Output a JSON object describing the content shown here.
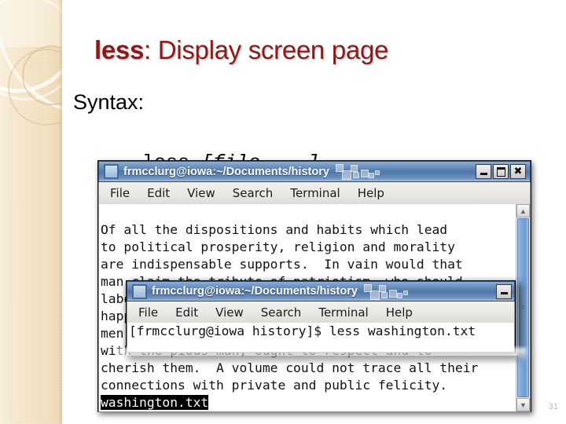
{
  "slide": {
    "title_command": "less",
    "title_rest": ": Display screen page",
    "title_color": "#8B1A1A",
    "syntax_label": "Syntax:",
    "syntax_command": "less ",
    "syntax_argument": "[file ...]",
    "page_number": "31"
  },
  "terminal_back": {
    "window_title": "frmcclurg@iowa:~/Documents/history",
    "window_icon": "terminal-window-icon",
    "buttons": {
      "minimize": "minimize-icon",
      "maximize": "maximize-icon",
      "close": "close-icon"
    },
    "menu": [
      "File",
      "Edit",
      "View",
      "Search",
      "Terminal",
      "Help"
    ],
    "lines": [
      "Of all the dispositions and habits which lead",
      "to political prosperity, religion and morality",
      "are indispensable supports.  In vain would that",
      "man claim the tribute of patriotism, who should",
      "labor to subvert these great pillars of human",
      "happiness, these firmest props of the duties of",
      "men and citizens.  The mere politician, equally",
      "with the pious man, ought to respect and to",
      "cherish them.  A volume could not trace all their",
      "connections with private and public felicity."
    ],
    "status_line": "washington.txt",
    "scrollbar": {
      "up_arrow": "chevron-up-icon",
      "down_arrow": "chevron-down-icon"
    }
  },
  "terminal_front": {
    "window_title": "frmcclurg@iowa:~/Documents/history",
    "window_icon": "terminal-window-icon",
    "buttons": {
      "minimize": "minimize-icon"
    },
    "menu": [
      "File",
      "Edit",
      "View",
      "Search",
      "Terminal",
      "Help"
    ],
    "prompt_line": "[frmcclurg@iowa history]$ less washington.txt"
  }
}
